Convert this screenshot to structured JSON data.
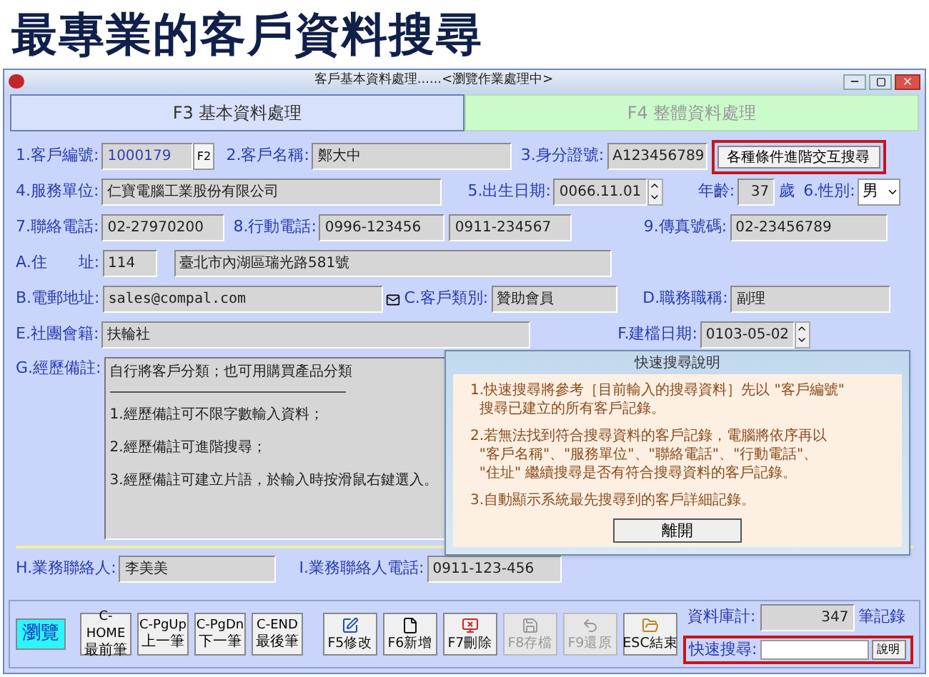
{
  "header_title": "最專業的客戶資料搜尋",
  "window": {
    "title": "客戶基本資料處理......<瀏覽作業處理中>"
  },
  "tabs": [
    {
      "label": "F3 基本資料處理",
      "selected": true
    },
    {
      "label": "F4 整體資料處理",
      "selected": false
    }
  ],
  "form": {
    "customer_no": {
      "label": "1.客戶編號:",
      "value": "1000179",
      "button": "F2"
    },
    "customer_name": {
      "label": "2.客戶名稱:",
      "value": "鄭大中"
    },
    "id_no": {
      "label": "3.身分證號:",
      "value": "A123456789"
    },
    "advanced_search_button": "各種條件進階交互搜尋",
    "employer": {
      "label": "4.服務單位:",
      "value": "仁寶電腦工業股份有限公司"
    },
    "birth_date": {
      "label": "5.出生日期:",
      "value": "0066.11.01"
    },
    "age": {
      "label": "年齡:",
      "value": "37",
      "unit": "歲"
    },
    "gender": {
      "label": "6.性別:",
      "value": "男"
    },
    "phone": {
      "label": "7.聯絡電話:",
      "value": "02-27970200"
    },
    "mobile": {
      "label": "8.行動電話:",
      "values": [
        "0996-123456",
        "0911-234567"
      ]
    },
    "fax": {
      "label": "9.傳真號碼:",
      "value": "02-23456789"
    },
    "address": {
      "label": "A.住　　址:",
      "zip": "114",
      "value": "臺北市內湖區瑞光路581號"
    },
    "email": {
      "label": "B.電郵地址:",
      "value": "sales@compal.com"
    },
    "category": {
      "label": "C.客戶類別:",
      "value": "贊助會員"
    },
    "job_title": {
      "label": "D.職務職稱:",
      "value": "副理"
    },
    "club": {
      "label": "E.社團會籍:",
      "value": "扶輪社"
    },
    "created_date": {
      "label": "F.建檔日期:",
      "value": "0103-05-02"
    },
    "notes": {
      "label": "G.經歷備註:",
      "first_line": "自行將客戶分類；也可用購買產品分類",
      "lines": [
        "1.經歷備註可不限字數輸入資料；",
        "2.經歷備註可進階搜尋；",
        "3.經歷備註可建立片語，於輸入時按滑鼠右鍵選入。"
      ]
    },
    "contact": {
      "label": "H.業務聯絡人:",
      "value": "李美美"
    },
    "contact_phone": {
      "label": "I.業務聯絡人電話:",
      "value": "0911-123-456"
    }
  },
  "dialog": {
    "title": "快速搜尋說明",
    "paragraphs": [
      "1.快速搜尋將參考［目前輸入的搜尋資料］先以 \"客戶編號\"\n  搜尋已建立的所有客戶記錄。",
      "2.若無法找到符合搜尋資料的客戶記錄，電腦將依序再以\n  \"客戶名稱\"、\"服務單位\"、\"聯絡電話\"、\"行動電話\"、\n  \"住址\" 繼續搜尋是否有符合搜尋資料的客戶記錄。",
      "3.自動顯示系統最先搜尋到的客戶詳細記錄。"
    ],
    "button": "離開"
  },
  "toolbar": {
    "mode": "瀏覽",
    "nav_buttons": [
      {
        "top": "C-HOME",
        "bottom": "最前筆"
      },
      {
        "top": "C-PgUp",
        "bottom": "上一筆"
      },
      {
        "top": "C-PgDn",
        "bottom": "下一筆"
      },
      {
        "top": "C-END",
        "bottom": "最後筆"
      }
    ],
    "actions": [
      {
        "kind": "edit",
        "label": "F5修改",
        "disabled": false
      },
      {
        "kind": "new",
        "label": "F6新增",
        "disabled": false
      },
      {
        "kind": "delete",
        "label": "F7刪除",
        "disabled": false
      },
      {
        "kind": "save",
        "label": "F8存檔",
        "disabled": true
      },
      {
        "kind": "undo",
        "label": "F9還原",
        "disabled": true
      },
      {
        "kind": "exit",
        "label": "ESC結束",
        "disabled": false
      }
    ],
    "record_count": {
      "label": "資料庫計:",
      "value": "347",
      "unit": "筆記錄"
    },
    "quick_search": {
      "label": "快速搜尋:",
      "button": "說明"
    }
  }
}
